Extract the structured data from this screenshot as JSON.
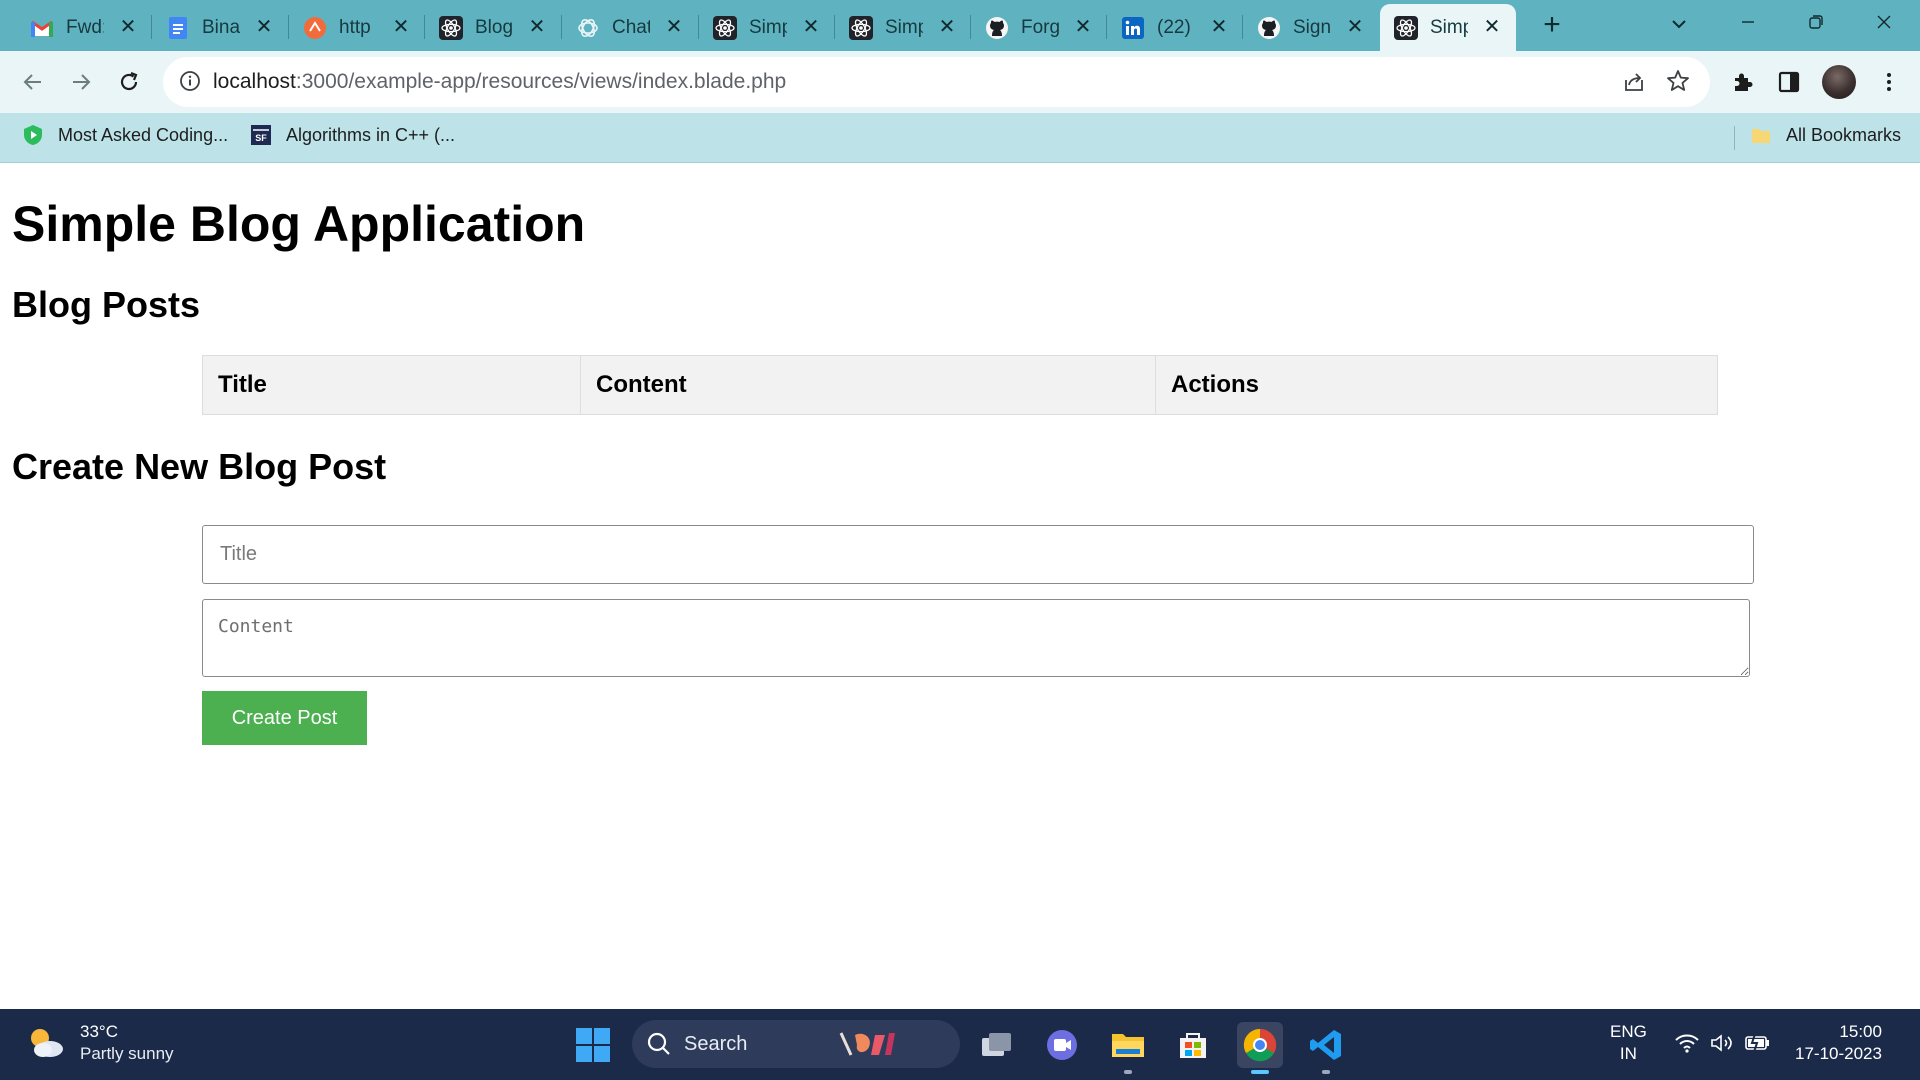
{
  "browser": {
    "tabs": [
      {
        "title": "Fwd:",
        "icon": "gmail-icon"
      },
      {
        "title": "Bina",
        "icon": "google-docs-icon"
      },
      {
        "title": "http",
        "icon": "orange-circle-icon"
      },
      {
        "title": "Blog",
        "icon": "react-icon"
      },
      {
        "title": "Chat",
        "icon": "chatgpt-icon"
      },
      {
        "title": "Simp",
        "icon": "react-icon"
      },
      {
        "title": "Simp",
        "icon": "react-icon"
      },
      {
        "title": "Forg",
        "icon": "github-icon"
      },
      {
        "title": "(22)",
        "icon": "linkedin-icon"
      },
      {
        "title": "Sign",
        "icon": "github-icon"
      },
      {
        "title": "Simp",
        "icon": "react-icon",
        "active": true
      }
    ],
    "url_host": "localhost",
    "url_path": ":3000/example-app/resources/views/index.blade.php",
    "bookmarks": [
      {
        "label": "Most Asked Coding...",
        "icon": "green-shield-icon"
      },
      {
        "label": "Algorithms in C++ (...",
        "icon": "sf-icon"
      }
    ],
    "all_bookmarks": "All Bookmarks"
  },
  "page": {
    "title": "Simple Blog Application",
    "posts_heading": "Blog Posts",
    "table_headers": [
      "Title",
      "Content",
      "Actions"
    ],
    "create_heading": "Create New Blog Post",
    "title_placeholder": "Title",
    "content_placeholder": "Content",
    "submit_label": "Create Post"
  },
  "taskbar": {
    "weather_temp": "33°C",
    "weather_desc": "Partly sunny",
    "search_label": "Search",
    "lang_top": "ENG",
    "lang_bottom": "IN",
    "time": "15:00",
    "date": "17-10-2023"
  },
  "colors": {
    "tabstrip": "#5fb3c0",
    "toolbar": "#e9f5f7",
    "bookmarks_bar": "#bde3e9",
    "button_green": "#4caf50",
    "table_header_bg": "#f2f2f2",
    "taskbar": "#1c2a4a"
  }
}
